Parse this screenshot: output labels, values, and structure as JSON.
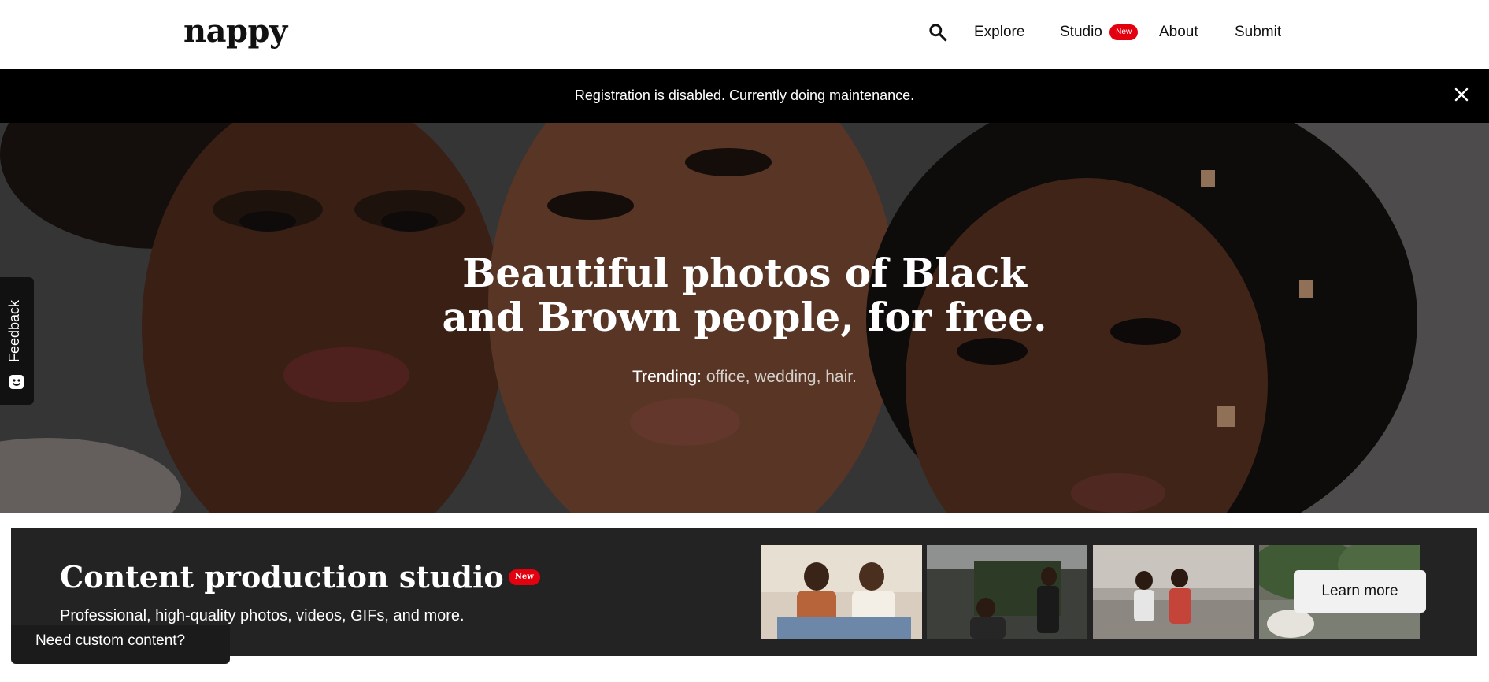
{
  "header": {
    "logo": "nappy",
    "search_icon": "search-icon",
    "nav": [
      {
        "label": "Explore"
      },
      {
        "label": "Studio",
        "badge": "New"
      },
      {
        "label": "About"
      },
      {
        "label": "Submit"
      }
    ]
  },
  "banner": {
    "message": "Registration is disabled. Currently doing maintenance.",
    "close_icon": "close-icon"
  },
  "hero": {
    "title_line1": "Beautiful photos of Black",
    "title_line2": "and Brown people, for free.",
    "trending_label": "Trending:",
    "trending_terms": [
      "office",
      "wedding",
      "hair."
    ]
  },
  "feedback": {
    "label": "Feedback",
    "icon": "smiley-icon"
  },
  "studio": {
    "title": "Content production studio",
    "badge": "New",
    "subtitle": "Professional, high-quality photos, videos, GIFs, and more.",
    "button_label": "Learn more",
    "thumbnails": [
      "thumbnail-1",
      "thumbnail-2",
      "thumbnail-3",
      "thumbnail-4"
    ]
  },
  "custom_content": {
    "label": "Need custom content?"
  },
  "colors": {
    "badge_red": "#e3000f",
    "banner_bg": "#000000",
    "studio_bg": "#232323"
  }
}
